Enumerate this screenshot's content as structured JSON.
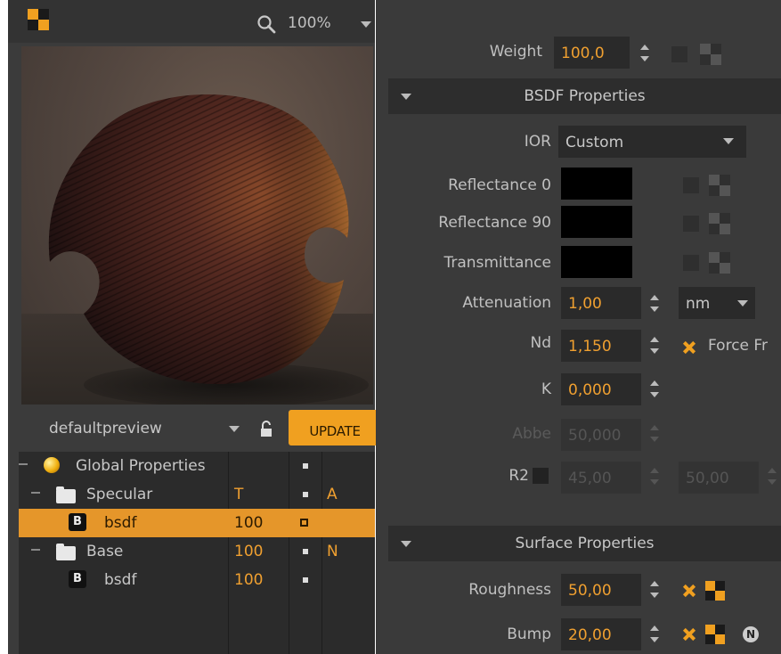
{
  "preview": {
    "zoom": "100%",
    "preview_name": "defaultpreview",
    "update_label": "UPDATE"
  },
  "tree": {
    "rows": [
      {
        "name": "Global Properties",
        "col1": "",
        "col2": "▪",
        "col3": ""
      },
      {
        "name": "Specular",
        "col1": "T",
        "col2": "▪",
        "col3": "A"
      },
      {
        "name": "bsdf",
        "col1": "100",
        "col2": "▫",
        "col3": "",
        "badge": "B"
      },
      {
        "name": "Base",
        "col1": "100",
        "col2": "▪",
        "col3": "N"
      },
      {
        "name": "bsdf",
        "col1": "100",
        "col2": "▪",
        "col3": "",
        "badge": "B"
      }
    ]
  },
  "properties": {
    "weight_label": "Weight",
    "weight_value": "100,0",
    "bsdf_section": "BSDF Properties",
    "ior_label": "IOR",
    "ior_value": "Custom",
    "reflectance0_label": "Reflectance 0",
    "reflectance90_label": "Reflectance 90",
    "transmittance_label": "Transmittance",
    "attenuation_label": "Attenuation",
    "attenuation_value": "1,00",
    "attenuation_unit": "nm",
    "nd_label": "Nd",
    "nd_value": "1,150",
    "force_fresnel_label": "Force Fr",
    "k_label": "K",
    "k_value": "0,000",
    "abbe_label": "Abbe",
    "abbe_value": "50,000",
    "r2_label": "R2",
    "r2_value1": "45,00",
    "r2_value2": "50,00",
    "surface_section": "Surface Properties",
    "roughness_label": "Roughness",
    "roughness_value": "50,00",
    "bump_label": "Bump",
    "bump_value": "20,00",
    "normal_badge": "N"
  },
  "colors": {
    "accent": "#f0a020",
    "panel": "#3a3a3a",
    "field": "#2a2a2a"
  }
}
